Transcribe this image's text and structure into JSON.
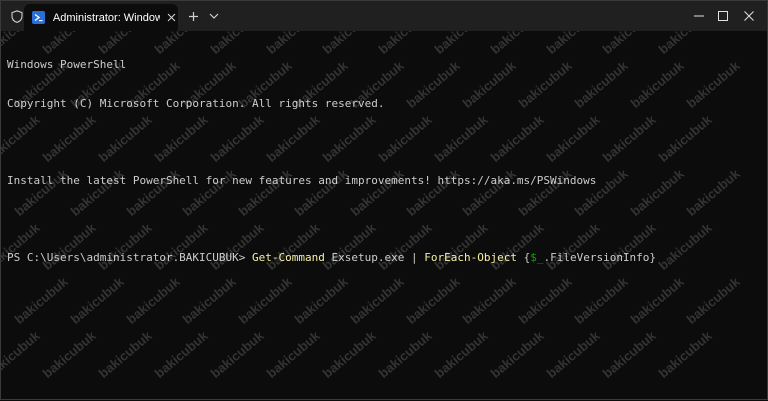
{
  "window": {
    "tab_title": "Administrator: Windows PowerShell",
    "new_tab_symbol": "+",
    "icons": {
      "shield": "shield-icon",
      "powershell": "powershell-icon",
      "close_tab": "close-icon",
      "dropdown": "chevron-down-icon",
      "minimize": "minimize-icon",
      "maximize": "maximize-icon",
      "close_window": "close-icon"
    }
  },
  "terminal": {
    "lines": [
      "Windows PowerShell",
      "Copyright (C) Microsoft Corporation. All rights reserved.",
      "",
      "Install the latest PowerShell for new features and improvements! https://aka.ms/PSWindows",
      ""
    ],
    "prompt": "PS C:\\Users\\administrator.BAKICUBUK> ",
    "command_tokens": [
      {
        "text": "Get-Command",
        "kind": "cmd"
      },
      {
        "text": " Exsetup.exe | ",
        "kind": "param"
      },
      {
        "text": "ForEach-Object",
        "kind": "cmd"
      },
      {
        "text": " {",
        "kind": "param"
      },
      {
        "text": "$_",
        "kind": "var"
      },
      {
        "text": ".FileVersionInfo}",
        "kind": "param"
      }
    ]
  },
  "watermark": "bakicubuk",
  "colors": {
    "background": "#0c0c0c",
    "titlebar": "#202020",
    "text": "#cccccc",
    "command": "#f9f1a5",
    "variable": "#13a10e"
  }
}
